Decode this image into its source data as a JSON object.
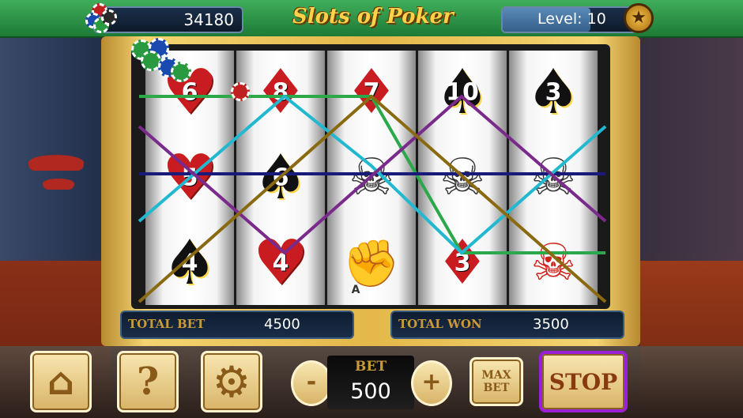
{
  "header": {
    "credits": "34180",
    "title": "Slots of Poker",
    "level_label": "Level:",
    "level_value": "10",
    "level_progress": 0.66
  },
  "reels": [
    [
      {
        "type": "heart",
        "rank": "6"
      },
      {
        "type": "heart",
        "rank": "5"
      },
      {
        "type": "spade",
        "rank": "4"
      }
    ],
    [
      {
        "type": "diamond",
        "rank": "8"
      },
      {
        "type": "spade",
        "rank": "6"
      },
      {
        "type": "heart",
        "rank": "4"
      }
    ],
    [
      {
        "type": "diamond",
        "rank": "7"
      },
      {
        "type": "skull",
        "rank": ""
      },
      {
        "type": "fist",
        "rank": "A"
      }
    ],
    [
      {
        "type": "spade",
        "rank": "10"
      },
      {
        "type": "skull",
        "rank": ""
      },
      {
        "type": "diamond",
        "rank": "3"
      }
    ],
    [
      {
        "type": "spade",
        "rank": "3"
      },
      {
        "type": "skull",
        "rank": ""
      },
      {
        "type": "skull-red",
        "rank": ""
      }
    ]
  ],
  "paylines": [
    {
      "color": "#2aa84a"
    },
    {
      "color": "#1a1a7a"
    },
    {
      "color": "#22b8d0"
    },
    {
      "color": "#7a2a8a"
    },
    {
      "color": "#8a6a10"
    }
  ],
  "totals": {
    "total_bet_label": "TOTAL BET",
    "total_bet_value": "4500",
    "total_won_label": "TOTAL WON",
    "total_won_value": "3500"
  },
  "controls": {
    "home_icon": "home-icon",
    "help_label": "?",
    "settings_icon": "gear-icon",
    "minus_label": "-",
    "bet_label": "BET",
    "bet_value": "500",
    "plus_label": "+",
    "max_bet_label": "MAX BET",
    "stop_label": "STOP"
  }
}
